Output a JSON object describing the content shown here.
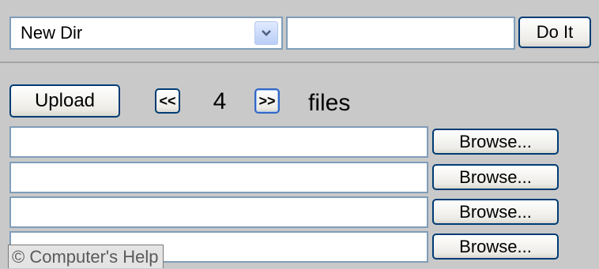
{
  "toolbar": {
    "action_select": {
      "value": "New Dir",
      "arrow_icon": "chevron-down-icon"
    },
    "action_input": {
      "value": "",
      "placeholder": ""
    },
    "doit_label": "Do It"
  },
  "upload": {
    "upload_label": "Upload",
    "prev_label": "<<",
    "next_label": ">>",
    "file_count": "4",
    "files_label": "files"
  },
  "file_rows": [
    {
      "path": "",
      "browse_label": "Browse..."
    },
    {
      "path": "",
      "browse_label": "Browse..."
    },
    {
      "path": "",
      "browse_label": "Browse..."
    },
    {
      "path": "",
      "browse_label": "Browse..."
    }
  ],
  "watermark": "© Computer's Help",
  "colors": {
    "background": "#c9c9c9",
    "input_border": "#7f9db9",
    "button_border": "#003c74",
    "dropdown_arrow": "#4d6185"
  }
}
